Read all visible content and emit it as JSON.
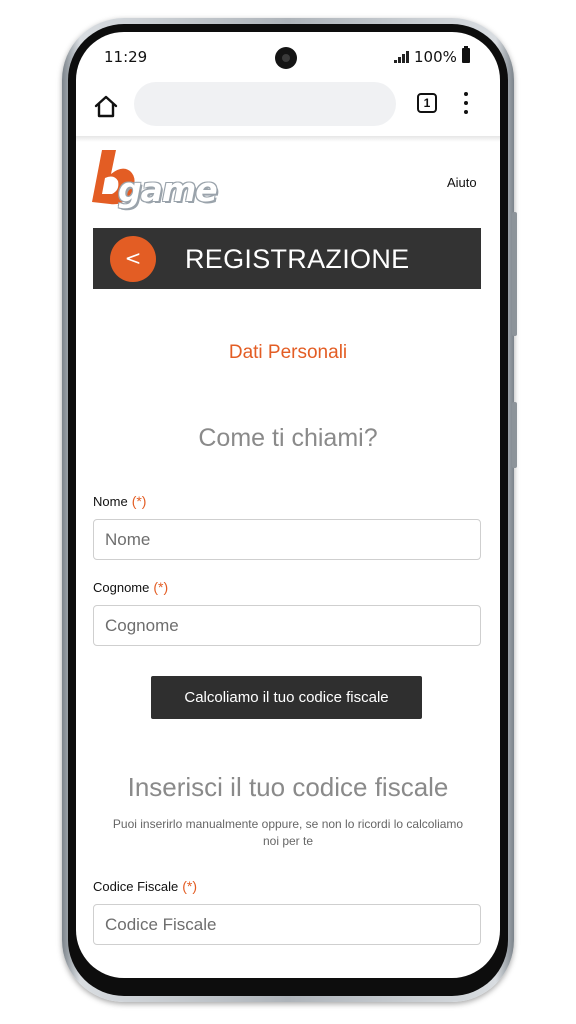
{
  "status_bar": {
    "time": "11:29",
    "battery": "100%"
  },
  "browser": {
    "tab_count": "1"
  },
  "header": {
    "logo_text": "game",
    "help_link": "Aiuto",
    "brand_color": "#e35d24"
  },
  "registration": {
    "back_label": "<",
    "title": "REGISTRAZIONE"
  },
  "form": {
    "section_title": "Dati Personali",
    "name_heading": "Come ti chiami?",
    "name_label": "Nome",
    "name_placeholder": "Nome",
    "surname_label": "Cognome",
    "surname_placeholder": "Cognome",
    "required_marker": "(*)",
    "calc_button": "Calcoliamo il tuo codice fiscale",
    "cf_heading": "Inserisci il tuo codice fiscale",
    "cf_hint": "Puoi inserirlo manualmente oppure, se non lo ricordi lo calcoliamo noi per te",
    "cf_label": "Codice Fiscale",
    "cf_placeholder": "Codice Fiscale"
  }
}
